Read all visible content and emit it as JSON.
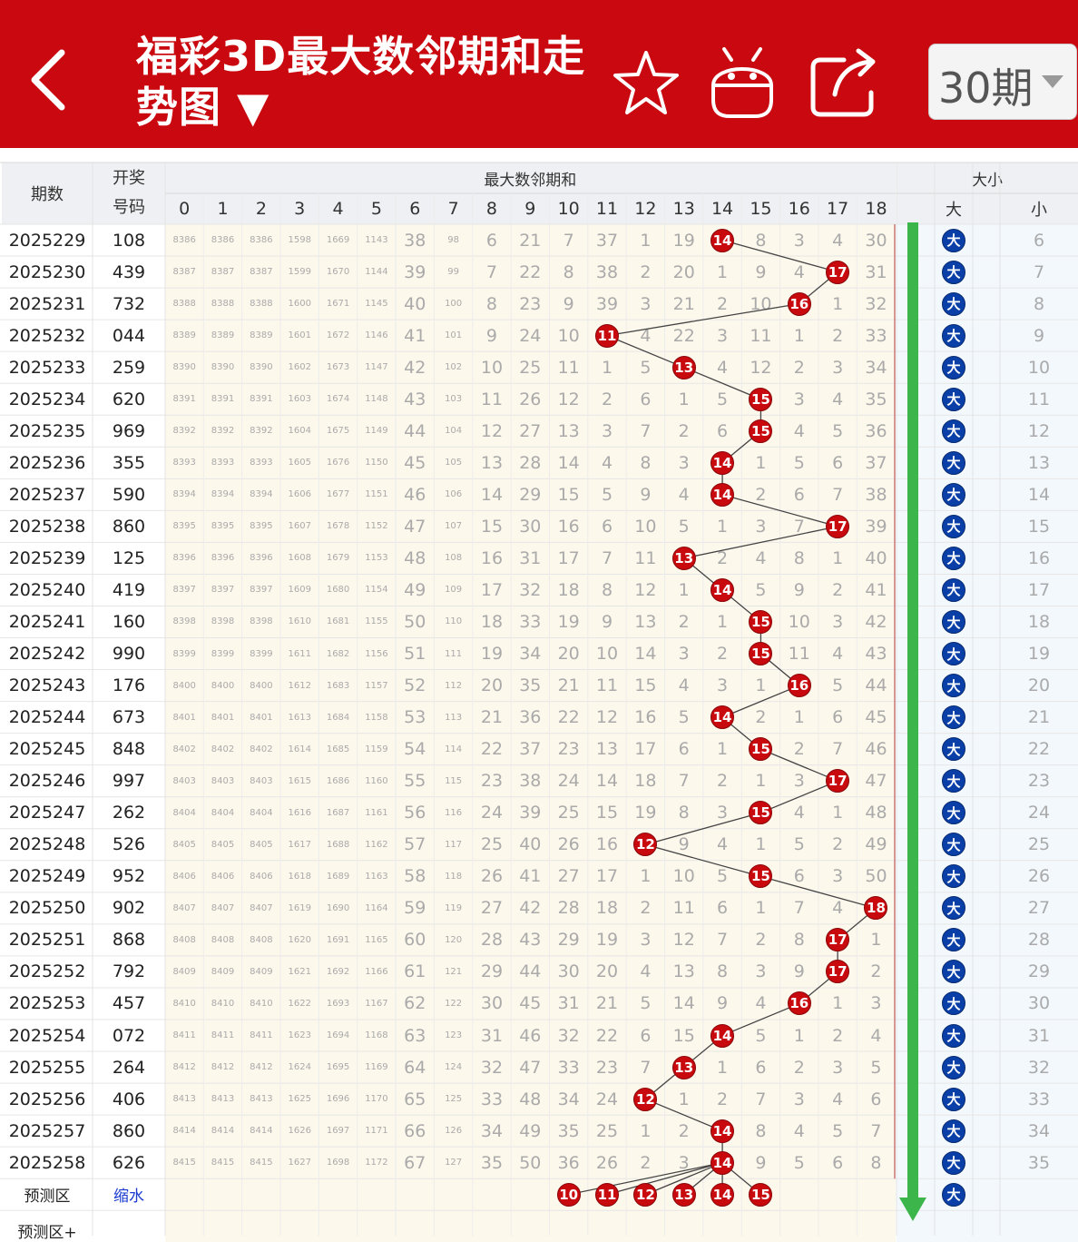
{
  "header": {
    "back_icon": "chevron-left-icon",
    "title": "福彩3D最大数邻期和走势图 ▼",
    "favorite_icon": "star-icon",
    "android_icon": "android-robot-icon",
    "share_icon": "share-icon",
    "period_select": "30期"
  },
  "table": {
    "col_period": "期数",
    "col_draw": "开奖号码",
    "group_sum": "最大数邻期和",
    "group_size": "大小",
    "sum_cols": [
      "0",
      "1",
      "2",
      "3",
      "4",
      "5",
      "6",
      "7",
      "8",
      "9",
      "10",
      "11",
      "12",
      "13",
      "14",
      "15",
      "16",
      "17",
      "18"
    ],
    "size_big": "大",
    "size_small": "小",
    "rows": [
      {
        "period": "2025229",
        "draw": "108",
        "vals": [
          "8386",
          "8386",
          "8386",
          "1598",
          "1669",
          "1143",
          "38",
          "98",
          "6",
          "21",
          "7",
          "37",
          "1",
          "19",
          "14",
          "8",
          "3",
          "4",
          "30"
        ],
        "hit": 14,
        "small": "6"
      },
      {
        "period": "2025230",
        "draw": "439",
        "vals": [
          "8387",
          "8387",
          "8387",
          "1599",
          "1670",
          "1144",
          "39",
          "99",
          "7",
          "22",
          "8",
          "38",
          "2",
          "20",
          "1",
          "9",
          "4",
          "17",
          "31"
        ],
        "hit": 17,
        "small": "7"
      },
      {
        "period": "2025231",
        "draw": "732",
        "vals": [
          "8388",
          "8388",
          "8388",
          "1600",
          "1671",
          "1145",
          "40",
          "100",
          "8",
          "23",
          "9",
          "39",
          "3",
          "21",
          "2",
          "10",
          "16",
          "1",
          "32"
        ],
        "hit": 16,
        "small": "8"
      },
      {
        "period": "2025232",
        "draw": "044",
        "vals": [
          "8389",
          "8389",
          "8389",
          "1601",
          "1672",
          "1146",
          "41",
          "101",
          "9",
          "24",
          "10",
          "11",
          "4",
          "22",
          "3",
          "11",
          "1",
          "2",
          "33"
        ],
        "hit": 11,
        "small": "9"
      },
      {
        "period": "2025233",
        "draw": "259",
        "vals": [
          "8390",
          "8390",
          "8390",
          "1602",
          "1673",
          "1147",
          "42",
          "102",
          "10",
          "25",
          "11",
          "1",
          "5",
          "13",
          "4",
          "12",
          "2",
          "3",
          "34"
        ],
        "hit": 13,
        "small": "10"
      },
      {
        "period": "2025234",
        "draw": "620",
        "vals": [
          "8391",
          "8391",
          "8391",
          "1603",
          "1674",
          "1148",
          "43",
          "103",
          "11",
          "26",
          "12",
          "2",
          "6",
          "1",
          "5",
          "15",
          "3",
          "4",
          "35"
        ],
        "hit": 15,
        "small": "11"
      },
      {
        "period": "2025235",
        "draw": "969",
        "vals": [
          "8392",
          "8392",
          "8392",
          "1604",
          "1675",
          "1149",
          "44",
          "104",
          "12",
          "27",
          "13",
          "3",
          "7",
          "2",
          "6",
          "15",
          "4",
          "5",
          "36"
        ],
        "hit": 15,
        "small": "12"
      },
      {
        "period": "2025236",
        "draw": "355",
        "vals": [
          "8393",
          "8393",
          "8393",
          "1605",
          "1676",
          "1150",
          "45",
          "105",
          "13",
          "28",
          "14",
          "4",
          "8",
          "3",
          "14",
          "1",
          "5",
          "6",
          "37"
        ],
        "hit": 14,
        "small": "13"
      },
      {
        "period": "2025237",
        "draw": "590",
        "vals": [
          "8394",
          "8394",
          "8394",
          "1606",
          "1677",
          "1151",
          "46",
          "106",
          "14",
          "29",
          "15",
          "5",
          "9",
          "4",
          "14",
          "2",
          "6",
          "7",
          "38"
        ],
        "hit": 14,
        "small": "14"
      },
      {
        "period": "2025238",
        "draw": "860",
        "vals": [
          "8395",
          "8395",
          "8395",
          "1607",
          "1678",
          "1152",
          "47",
          "107",
          "15",
          "30",
          "16",
          "6",
          "10",
          "5",
          "1",
          "3",
          "7",
          "17",
          "39"
        ],
        "hit": 17,
        "small": "15"
      },
      {
        "period": "2025239",
        "draw": "125",
        "vals": [
          "8396",
          "8396",
          "8396",
          "1608",
          "1679",
          "1153",
          "48",
          "108",
          "16",
          "31",
          "17",
          "7",
          "11",
          "13",
          "2",
          "4",
          "8",
          "1",
          "40"
        ],
        "hit": 13,
        "small": "16"
      },
      {
        "period": "2025240",
        "draw": "419",
        "vals": [
          "8397",
          "8397",
          "8397",
          "1609",
          "1680",
          "1154",
          "49",
          "109",
          "17",
          "32",
          "18",
          "8",
          "12",
          "1",
          "14",
          "5",
          "9",
          "2",
          "41"
        ],
        "hit": 14,
        "small": "17"
      },
      {
        "period": "2025241",
        "draw": "160",
        "vals": [
          "8398",
          "8398",
          "8398",
          "1610",
          "1681",
          "1155",
          "50",
          "110",
          "18",
          "33",
          "19",
          "9",
          "13",
          "2",
          "1",
          "15",
          "10",
          "3",
          "42"
        ],
        "hit": 15,
        "small": "18"
      },
      {
        "period": "2025242",
        "draw": "990",
        "vals": [
          "8399",
          "8399",
          "8399",
          "1611",
          "1682",
          "1156",
          "51",
          "111",
          "19",
          "34",
          "20",
          "10",
          "14",
          "3",
          "2",
          "15",
          "11",
          "4",
          "43"
        ],
        "hit": 15,
        "small": "19"
      },
      {
        "period": "2025243",
        "draw": "176",
        "vals": [
          "8400",
          "8400",
          "8400",
          "1612",
          "1683",
          "1157",
          "52",
          "112",
          "20",
          "35",
          "21",
          "11",
          "15",
          "4",
          "3",
          "1",
          "16",
          "5",
          "44"
        ],
        "hit": 16,
        "small": "20"
      },
      {
        "period": "2025244",
        "draw": "673",
        "vals": [
          "8401",
          "8401",
          "8401",
          "1613",
          "1684",
          "1158",
          "53",
          "113",
          "21",
          "36",
          "22",
          "12",
          "16",
          "5",
          "14",
          "2",
          "1",
          "6",
          "45"
        ],
        "hit": 14,
        "small": "21"
      },
      {
        "period": "2025245",
        "draw": "848",
        "vals": [
          "8402",
          "8402",
          "8402",
          "1614",
          "1685",
          "1159",
          "54",
          "114",
          "22",
          "37",
          "23",
          "13",
          "17",
          "6",
          "1",
          "15",
          "2",
          "7",
          "46"
        ],
        "hit": 15,
        "small": "22"
      },
      {
        "period": "2025246",
        "draw": "997",
        "vals": [
          "8403",
          "8403",
          "8403",
          "1615",
          "1686",
          "1160",
          "55",
          "115",
          "23",
          "38",
          "24",
          "14",
          "18",
          "7",
          "2",
          "1",
          "3",
          "17",
          "47"
        ],
        "hit": 17,
        "small": "23"
      },
      {
        "period": "2025247",
        "draw": "262",
        "vals": [
          "8404",
          "8404",
          "8404",
          "1616",
          "1687",
          "1161",
          "56",
          "116",
          "24",
          "39",
          "25",
          "15",
          "19",
          "8",
          "3",
          "15",
          "4",
          "1",
          "48"
        ],
        "hit": 15,
        "small": "24"
      },
      {
        "period": "2025248",
        "draw": "526",
        "vals": [
          "8405",
          "8405",
          "8405",
          "1617",
          "1688",
          "1162",
          "57",
          "117",
          "25",
          "40",
          "26",
          "16",
          "12",
          "9",
          "4",
          "1",
          "5",
          "2",
          "49"
        ],
        "hit": 12,
        "small": "25"
      },
      {
        "period": "2025249",
        "draw": "952",
        "vals": [
          "8406",
          "8406",
          "8406",
          "1618",
          "1689",
          "1163",
          "58",
          "118",
          "26",
          "41",
          "27",
          "17",
          "1",
          "10",
          "5",
          "15",
          "6",
          "3",
          "50"
        ],
        "hit": 15,
        "small": "26"
      },
      {
        "period": "2025250",
        "draw": "902",
        "vals": [
          "8407",
          "8407",
          "8407",
          "1619",
          "1690",
          "1164",
          "59",
          "119",
          "27",
          "42",
          "28",
          "18",
          "2",
          "11",
          "6",
          "1",
          "7",
          "4",
          "18"
        ],
        "hit": 18,
        "small": "27"
      },
      {
        "period": "2025251",
        "draw": "868",
        "vals": [
          "8408",
          "8408",
          "8408",
          "1620",
          "1691",
          "1165",
          "60",
          "120",
          "28",
          "43",
          "29",
          "19",
          "3",
          "12",
          "7",
          "2",
          "8",
          "17",
          "1"
        ],
        "hit": 17,
        "small": "28"
      },
      {
        "period": "2025252",
        "draw": "792",
        "vals": [
          "8409",
          "8409",
          "8409",
          "1621",
          "1692",
          "1166",
          "61",
          "121",
          "29",
          "44",
          "30",
          "20",
          "4",
          "13",
          "8",
          "3",
          "9",
          "17",
          "2"
        ],
        "hit": 17,
        "small": "29"
      },
      {
        "period": "2025253",
        "draw": "457",
        "vals": [
          "8410",
          "8410",
          "8410",
          "1622",
          "1693",
          "1167",
          "62",
          "122",
          "30",
          "45",
          "31",
          "21",
          "5",
          "14",
          "9",
          "4",
          "16",
          "1",
          "3"
        ],
        "hit": 16,
        "small": "30"
      },
      {
        "period": "2025254",
        "draw": "072",
        "vals": [
          "8411",
          "8411",
          "8411",
          "1623",
          "1694",
          "1168",
          "63",
          "123",
          "31",
          "46",
          "32",
          "22",
          "6",
          "15",
          "14",
          "5",
          "1",
          "2",
          "4"
        ],
        "hit": 14,
        "small": "31"
      },
      {
        "period": "2025255",
        "draw": "264",
        "vals": [
          "8412",
          "8412",
          "8412",
          "1624",
          "1695",
          "1169",
          "64",
          "124",
          "32",
          "47",
          "33",
          "23",
          "7",
          "13",
          "1",
          "6",
          "2",
          "3",
          "5"
        ],
        "hit": 13,
        "small": "32"
      },
      {
        "period": "2025256",
        "draw": "406",
        "vals": [
          "8413",
          "8413",
          "8413",
          "1625",
          "1696",
          "1170",
          "65",
          "125",
          "33",
          "48",
          "34",
          "24",
          "12",
          "1",
          "2",
          "7",
          "3",
          "4",
          "6"
        ],
        "hit": 12,
        "small": "33"
      },
      {
        "period": "2025257",
        "draw": "860",
        "vals": [
          "8414",
          "8414",
          "8414",
          "1626",
          "1697",
          "1171",
          "66",
          "126",
          "34",
          "49",
          "35",
          "25",
          "1",
          "2",
          "14",
          "8",
          "4",
          "5",
          "7"
        ],
        "hit": 14,
        "small": "34"
      },
      {
        "period": "2025258",
        "draw": "626",
        "vals": [
          "8415",
          "8415",
          "8415",
          "1627",
          "1698",
          "1172",
          "67",
          "127",
          "35",
          "50",
          "36",
          "26",
          "2",
          "3",
          "14",
          "9",
          "5",
          "6",
          "8"
        ],
        "hit": 14,
        "small": "35"
      }
    ],
    "predict_label": "预测区",
    "predict_link": "缩水",
    "predict_balls": [
      "10",
      "11",
      "12",
      "13",
      "14",
      "15"
    ],
    "predict_big": "大",
    "predict_plus_label": "预测区+"
  },
  "colors": {
    "header_bg": "#c9090f",
    "ball_red": "#c8090e",
    "ball_blue": "#0a3fa8",
    "arrow_green": "#3cb54a"
  }
}
